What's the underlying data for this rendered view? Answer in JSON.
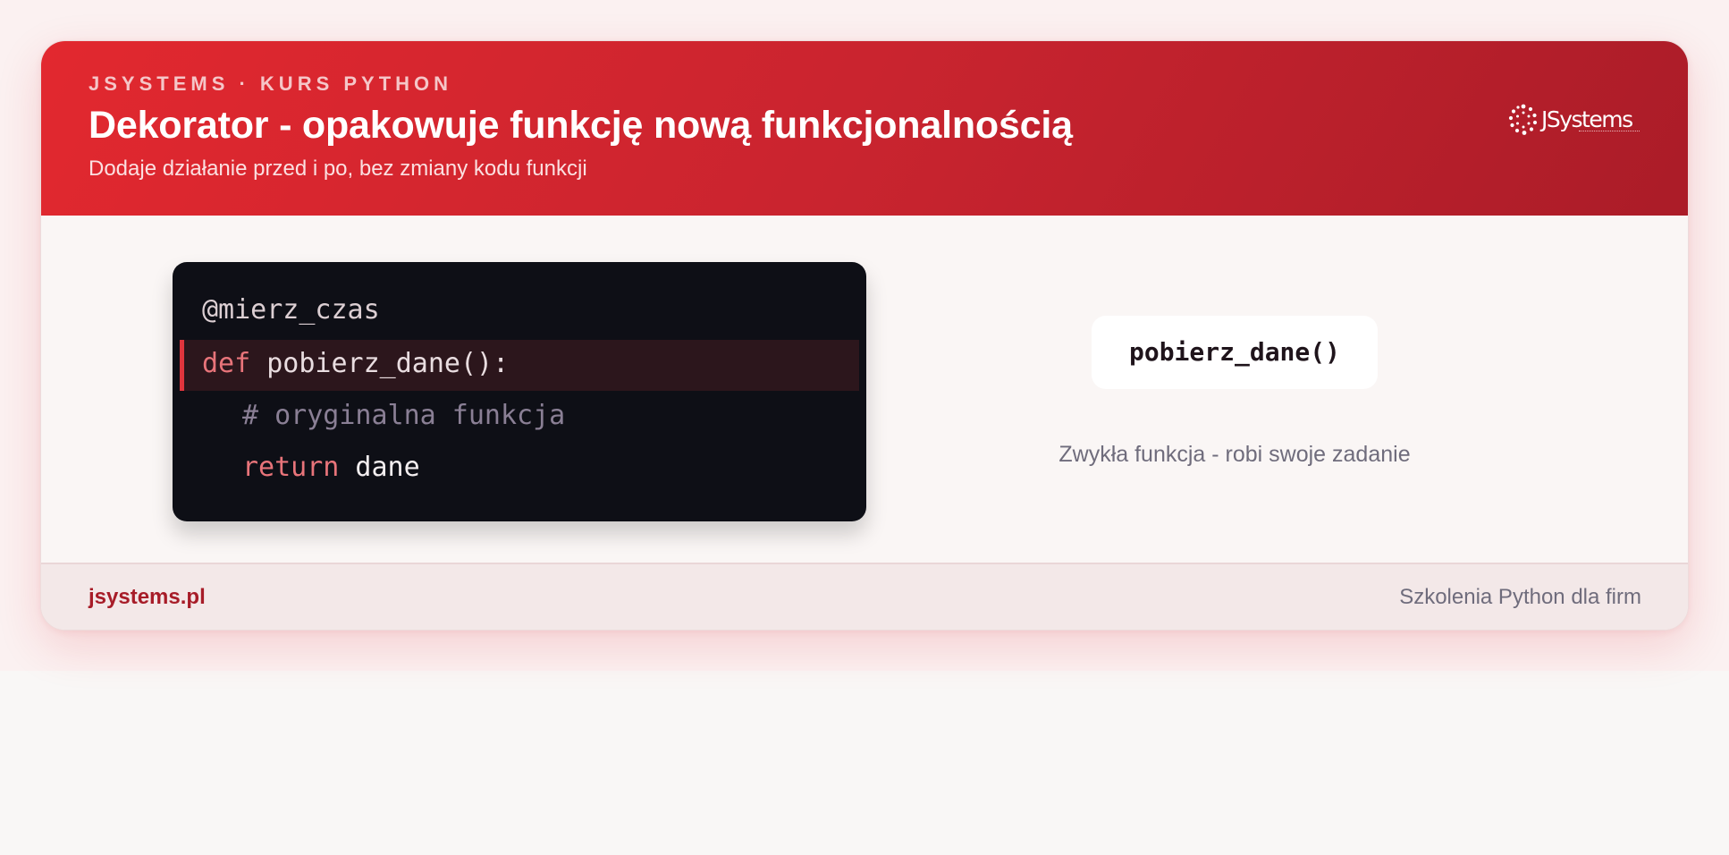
{
  "header": {
    "eyebrow": "JSYSTEMS · KURS PYTHON",
    "title": "Dekorator - opakowuje funkcję nową funkcjonalnością",
    "subtitle": "Dodaje działanie przed i po, bez zmiany kodu funkcji",
    "logo_text": "JSystems"
  },
  "code": {
    "line1": "@mierz_czas",
    "line2_keyword": "def",
    "line2_rest": " pobierz_dane():",
    "line3": "# oryginalna funkcja",
    "line4_keyword": "return",
    "line4_rest": " dane"
  },
  "call": {
    "label": "pobierz_dane()",
    "caption": "Zwykła funkcja - robi swoje zadanie"
  },
  "footer": {
    "site": "jsystems.pl",
    "tagline": "Szkolenia Python dla firm"
  },
  "colors": {
    "brand_red": "#d92630",
    "code_bg": "#0e0f16",
    "keyword": "#e8747a",
    "comment": "#8a7f95"
  }
}
